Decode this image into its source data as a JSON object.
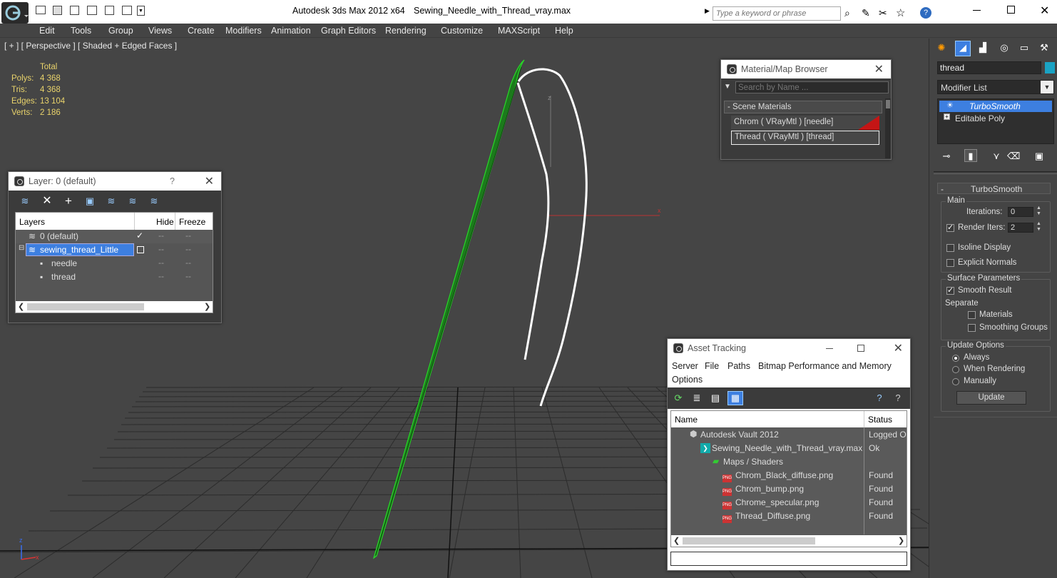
{
  "app": {
    "title": "Autodesk 3ds Max  2012 x64",
    "filename": "Sewing_Needle_with_Thread_vray.max",
    "search_placeholder": "Type a keyword or phrase"
  },
  "menu": [
    "Edit",
    "Tools",
    "Group",
    "Views",
    "Create",
    "Modifiers",
    "Animation",
    "Graph Editors",
    "Rendering",
    "Customize",
    "MAXScript",
    "Help"
  ],
  "viewport": {
    "label": "[ + ] [ Perspective ] [ Shaded + Edged Faces ]",
    "stats": {
      "header": "Total",
      "rows": [
        {
          "label": "Polys:",
          "value": "4 368"
        },
        {
          "label": "Tris:",
          "value": "4 368"
        },
        {
          "label": "Edges:",
          "value": "13 104"
        },
        {
          "label": "Verts:",
          "value": "2 186"
        }
      ]
    },
    "axis": {
      "z": "z",
      "x": "x"
    }
  },
  "layer_window": {
    "title": "Layer: 0 (default)",
    "help": "?",
    "columns": [
      "Layers",
      "Hide",
      "Freeze"
    ],
    "rows": [
      {
        "name": "0 (default)"
      },
      {
        "name": "sewing_thread_Little"
      },
      {
        "name": "needle"
      },
      {
        "name": "thread"
      }
    ]
  },
  "material_browser": {
    "title": "Material/Map Browser",
    "search_placeholder": "Search by Name ...",
    "section": "- Scene Materials",
    "items": [
      "Chrom  ( VRayMtl ) [needle]",
      "Thread  ( VRayMtl ) [thread]"
    ]
  },
  "asset_tracking": {
    "title": "Asset Tracking",
    "menu": [
      "Server",
      "File",
      "Paths",
      "Bitmap Performance and Memory",
      "Options"
    ],
    "columns": [
      "Name",
      "Status"
    ],
    "rows": [
      {
        "name": "Autodesk Vault 2012",
        "status": "Logged Ou"
      },
      {
        "name": "Sewing_Needle_with_Thread_vray.max",
        "status": "Ok"
      },
      {
        "name": "Maps / Shaders",
        "status": ""
      },
      {
        "name": "Chrom_Black_diffuse.png",
        "status": "Found"
      },
      {
        "name": "Chrom_bump.png",
        "status": "Found"
      },
      {
        "name": "Chrome_specular.png",
        "status": "Found"
      },
      {
        "name": "Thread_Diffuse.png",
        "status": "Found"
      }
    ],
    "png_badge": "PNG"
  },
  "command_panel": {
    "object_name": "thread",
    "modifier_list": "Modifier List",
    "stack": [
      "TurboSmooth",
      "Editable Poly"
    ],
    "rollout_title": "TurboSmooth",
    "main_label": "Main",
    "iterations_label": "Iterations:",
    "iterations_value": "0",
    "render_iters_label": "Render Iters:",
    "render_iters_value": "2",
    "isoline": "Isoline Display",
    "explicit": "Explicit Normals",
    "surface_label": "Surface Parameters",
    "smooth_result": "Smooth Result",
    "separate": "Separate",
    "materials": "Materials",
    "smoothing_groups": "Smoothing Groups",
    "update_options": "Update Options",
    "always": "Always",
    "when_rendering": "When Rendering",
    "manually": "Manually",
    "update_button": "Update"
  }
}
